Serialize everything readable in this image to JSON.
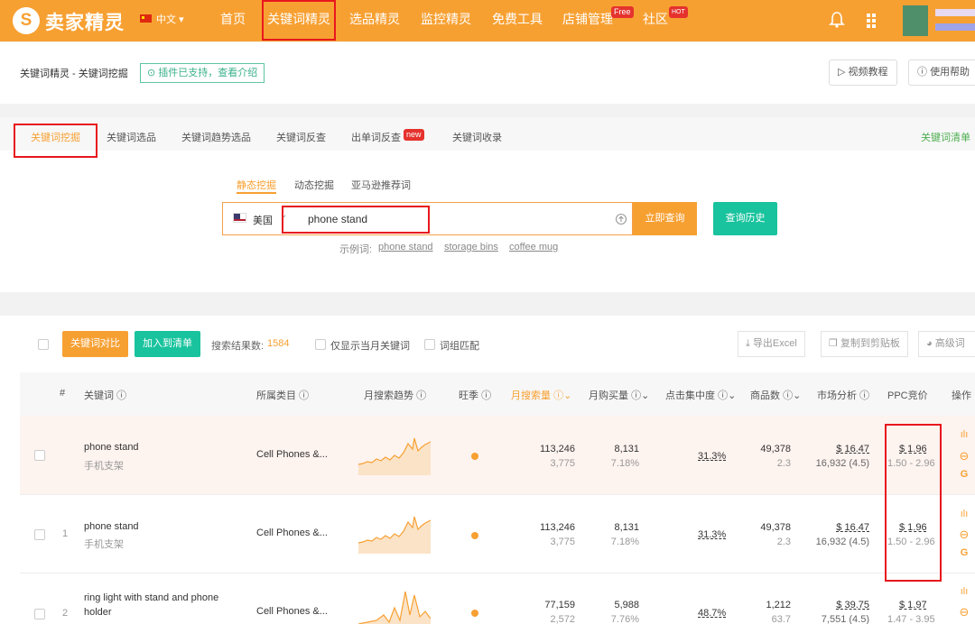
{
  "header": {
    "logo_glyph": "S",
    "brand": "卖家精灵",
    "lang": "中文",
    "nav": [
      {
        "label": "首页"
      },
      {
        "label": "关键词精灵"
      },
      {
        "label": "选品精灵"
      },
      {
        "label": "监控精灵"
      },
      {
        "label": "免费工具"
      },
      {
        "label": "店铺管理",
        "badge": "Free"
      },
      {
        "label": "社区",
        "badge": "HOT"
      }
    ]
  },
  "page": {
    "breadcrumb": "关键词精灵 - 关键词挖掘",
    "plugin_notice": "插件已支持，查看介绍",
    "video_btn": "视频教程",
    "help_btn": "使用帮助"
  },
  "tabs": [
    {
      "label": "关键词挖掘"
    },
    {
      "label": "关键词选品"
    },
    {
      "label": "关键词趋势选品"
    },
    {
      "label": "关键词反查"
    },
    {
      "label": "出单词反查",
      "badge": "new"
    },
    {
      "label": "关键词收录"
    }
  ],
  "keyword_list_link": "关键词清单",
  "subtabs": [
    {
      "label": "静态挖掘"
    },
    {
      "label": "动态挖掘"
    },
    {
      "label": "亚马逊推荐词"
    }
  ],
  "search": {
    "market": "美国",
    "query": "phone stand",
    "submit": "立即查询",
    "history": "查询历史",
    "example_label": "示例词:",
    "examples": [
      "phone stand",
      "storage bins",
      "coffee mug"
    ]
  },
  "toolbar": {
    "compare": "关键词对比",
    "add_list": "加入到清单",
    "result_label": "搜索结果数:",
    "result_count": "1584",
    "only_month": "仅显示当月关键词",
    "phrase_match": "词组匹配",
    "export": "导出Excel",
    "copy": "复制到剪贴板",
    "more": "高级词"
  },
  "table": {
    "columns": {
      "index": "#",
      "keyword": "关键词",
      "category": "所属类目",
      "trend": "月搜索趋势",
      "season": "旺季",
      "monthly_search": "月搜索量",
      "monthly_purchase": "月购买量",
      "click_conc": "点击集中度",
      "products": "商品数",
      "market": "市场分析",
      "ppc": "PPC竞价",
      "actions": "操作"
    },
    "rows": [
      {
        "index": "",
        "kw": "phone stand",
        "kw_cn": "手机支架",
        "category": "Cell Phones &...",
        "search": "113,246",
        "search_sub": "3,775",
        "purchase": "8,131",
        "purchase_sub": "7.18%",
        "click": "31.3%",
        "products": "49,378",
        "products_sub": "2.3",
        "market": "$ 16.47",
        "market_sub": "16,932 (4.5)",
        "ppc": "$ 1.96",
        "ppc_range": "1.50 - 2.96"
      },
      {
        "index": "1",
        "kw": "phone stand",
        "kw_cn": "手机支架",
        "category": "Cell Phones &...",
        "search": "113,246",
        "search_sub": "3,775",
        "purchase": "8,131",
        "purchase_sub": "7.18%",
        "click": "31.3%",
        "products": "49,378",
        "products_sub": "2.3",
        "market": "$ 16.47",
        "market_sub": "16,932 (4.5)",
        "ppc": "$ 1.96",
        "ppc_range": "1.50 - 2.96"
      },
      {
        "index": "2",
        "kw": "ring light with stand and phone",
        "kw2": "holder",
        "category": "Cell Phones &...",
        "search": "77,159",
        "search_sub": "2,572",
        "purchase": "5,988",
        "purchase_sub": "7.76%",
        "click": "48.7%",
        "products": "1,212",
        "products_sub": "63.7",
        "market": "$ 39.75",
        "market_sub": "7,551 (4.5)",
        "ppc": "$ 1.97",
        "ppc_range": "1.47 - 3.95"
      }
    ]
  },
  "colors": {
    "accent": "#f7a032",
    "green": "#19c39d",
    "highlight": "#e8171d"
  }
}
